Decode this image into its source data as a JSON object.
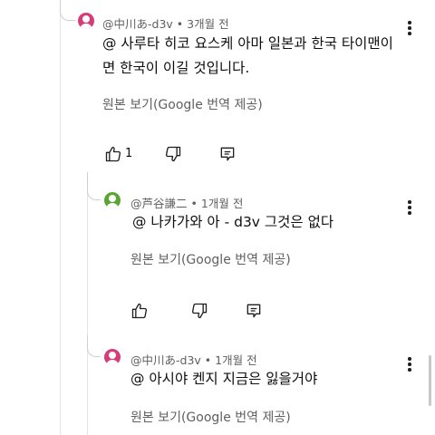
{
  "colors": {
    "avatar_pink": "#d63b7a",
    "avatar_green": "#5aa532",
    "meta_gray": "#606060"
  },
  "comments": [
    {
      "author": "@中川あ-d3v",
      "time": "3개월 전",
      "text_line1": "@ 사루타 히코 요스케 아마 일본과 한국 타이맨이",
      "text_line2": "면 한국이 이길 것입니다.",
      "translate": "원본 보기(Google 번역 제공)",
      "likes": "1"
    },
    {
      "author": "@芦谷謙二",
      "time": "1개월 전",
      "text_line1": "@ 나카가와 아 - d3v 그것은 없다",
      "translate": "원본 보기(Google 번역 제공)"
    },
    {
      "author": "@中川あ-d3v",
      "time": "1개월 전",
      "text_line1": "@ 아시야 켄지 지금은 잃을거야",
      "translate": "원본 보기(Google 번역 제공)"
    }
  ],
  "icons": [
    "like-icon",
    "dislike-icon",
    "reply-icon",
    "more-vert-icon"
  ]
}
